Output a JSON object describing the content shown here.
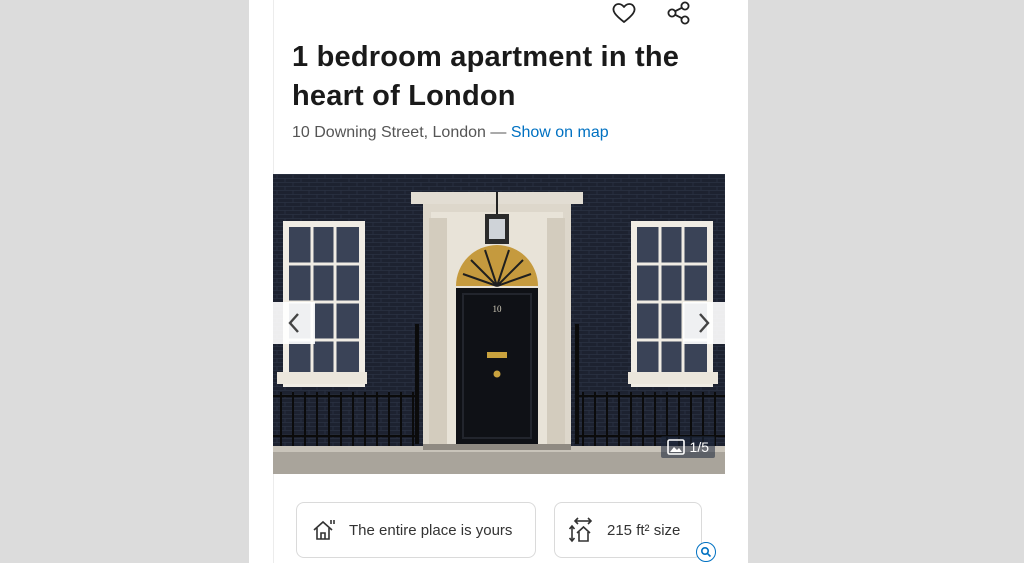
{
  "listing": {
    "title_line1": "1 bedroom apartment in the",
    "title_line2": "heart of London",
    "address": "10 Downing Street, London —",
    "map_link": "Show on map"
  },
  "actions": {
    "favorite_icon": "heart-icon",
    "share_icon": "share-icon"
  },
  "gallery": {
    "counter": "1/5",
    "door_number": "10",
    "prev_icon": "chevron-left-icon",
    "next_icon": "chevron-right-icon",
    "gallery_icon": "photo-gallery-icon"
  },
  "features": [
    {
      "icon": "house-icon",
      "label": "The entire place is yours"
    },
    {
      "icon": "size-icon",
      "label": "215 ft² size"
    }
  ],
  "colors": {
    "link": "#0071c2",
    "title": "#1a1a1a",
    "page_bg": "#dcdcdc"
  }
}
